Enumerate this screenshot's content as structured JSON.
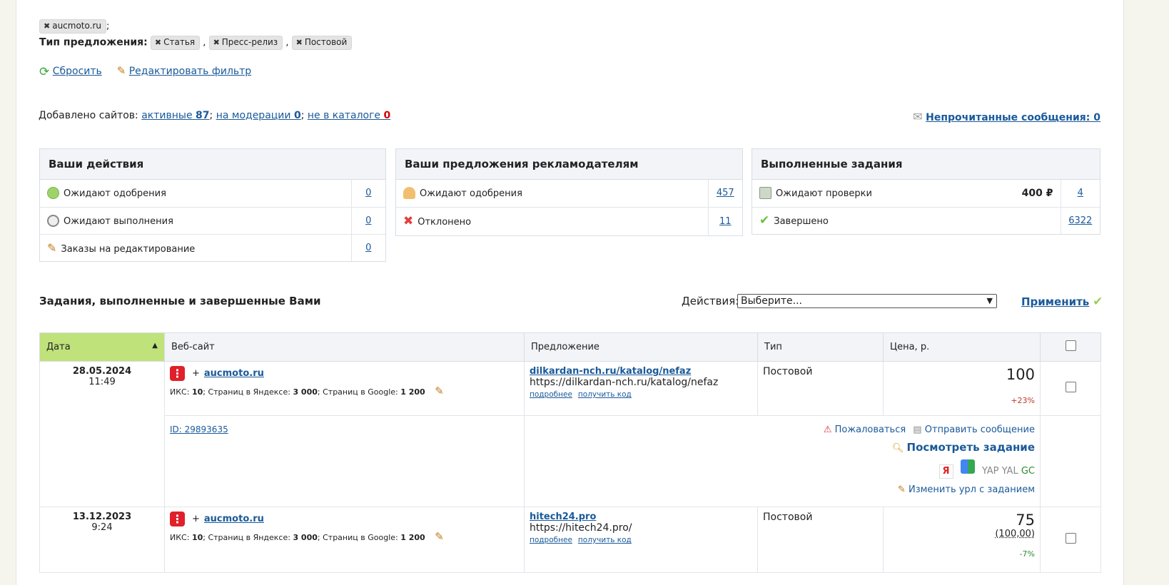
{
  "filter": {
    "site_chip": "aucmoto.ru",
    "site_sep": ";",
    "offer_type_label": "Тип предложения:",
    "offer_types": [
      "Статья",
      "Пресс-релиз",
      "Постовой"
    ],
    "reset_label": "Сбросить",
    "edit_label": "Редактировать фильтр"
  },
  "sites": {
    "prefix": "Добавлено сайтов:",
    "active_label": "активные",
    "active_count": "87",
    "moderation_label": "на модерации",
    "moderation_count": "0",
    "catalog_label": "не в каталоге",
    "catalog_count": "0",
    "unread_label": "Непрочитанные сообщения: 0"
  },
  "boxes": {
    "actions": {
      "title": "Ваши действия",
      "rows": [
        {
          "label": "Ожидают одобрения",
          "count": "0"
        },
        {
          "label": "Ожидают выполнения",
          "count": "0"
        },
        {
          "label": "Заказы на редактирование",
          "count": "0"
        }
      ]
    },
    "offers": {
      "title": "Ваши предложения рекламодателям",
      "rows": [
        {
          "label": "Ожидают одобрения",
          "count": "457"
        },
        {
          "label": "Отклонено",
          "count": "11"
        }
      ]
    },
    "completed": {
      "title": "Выполненные задания",
      "rows": [
        {
          "label": "Ожидают проверки",
          "amount": "400 ₽",
          "count": "4"
        },
        {
          "label": "Завершено",
          "count": "6322"
        }
      ]
    }
  },
  "section": {
    "title": "Задания, выполненные и завершенные Вами",
    "actions_label": "Действия:",
    "select_value": "Выберите...",
    "apply_label": "Применить"
  },
  "table": {
    "headers": [
      "Дата",
      "Веб-сайт",
      "Предложение",
      "Тип",
      "Цена, р."
    ],
    "rows": [
      {
        "date": "28.05.2024",
        "time": "11:49",
        "site": "aucmoto.ru",
        "metrics_iks_label": "ИКС:",
        "metrics_iks": "10",
        "metrics_yandex_label": "; Страниц в Яндексе:",
        "metrics_yandex": "3 000",
        "metrics_google_label": "; Страниц в Google:",
        "metrics_google": "1 200",
        "offer_link": "dilkardan-nch.ru/katalog/nefaz",
        "offer_url": "https://dilkardan-nch.ru/katalog/nefaz",
        "more": "подробнее",
        "get_code": "получить код",
        "type": "Постовой",
        "price": "100",
        "percent": "+23%",
        "id_label": "ID: 29893635",
        "complain": "Пожаловаться",
        "send_message": "Отправить сообщение",
        "view_task": "Посмотреть задание",
        "se_yap": "YAP",
        "se_yal": "YAL",
        "se_gc": "GC",
        "change_url": "Изменить урл с заданием"
      },
      {
        "date": "13.12.2023",
        "time": "9:24",
        "site": "aucmoto.ru",
        "metrics_iks_label": "ИКС:",
        "metrics_iks": "10",
        "metrics_yandex_label": "; Страниц в Яндексе:",
        "metrics_yandex": "3 000",
        "metrics_google_label": "; Страниц в Google:",
        "metrics_google": "1 200",
        "offer_link": "hitech24.pro",
        "offer_url": "https://hitech24.pro/",
        "more": "подробнее",
        "get_code": "получить код",
        "type": "Постовой",
        "price": "75",
        "old_price": "(100,00)",
        "percent": "-7%"
      }
    ]
  },
  "colors": {
    "link": "#1a5a9a",
    "sorted_header": "#bfe27a",
    "red_badge": "#e0202a",
    "positive": "#c0392b",
    "negative": "#2e8b2e"
  }
}
